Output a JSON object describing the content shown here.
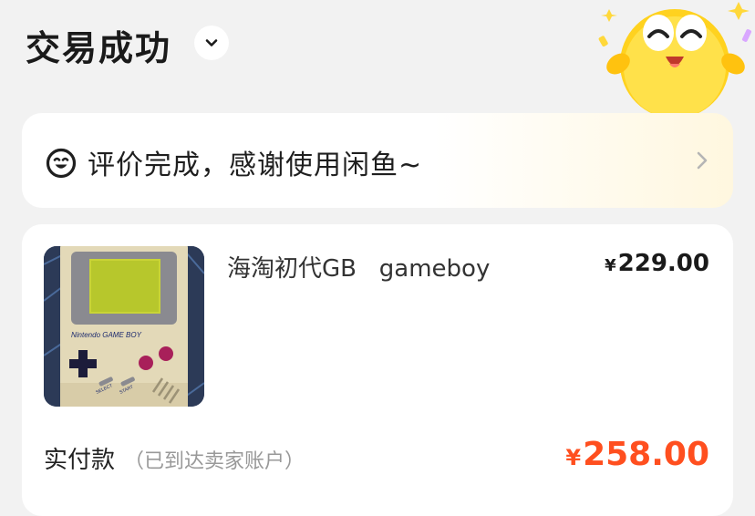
{
  "header": {
    "title": "交易成功",
    "toggle_icon": "chevron-down-icon"
  },
  "mascot": {
    "icon": "smiling-mascot-icon"
  },
  "review_banner": {
    "icon": "smile-face-icon",
    "text": "评价完成，感谢使用闲鱼~",
    "arrow_icon": "chevron-right-icon"
  },
  "order": {
    "product_title": "海淘初代GB   gameboy",
    "currency_symbol": "¥",
    "unit_price": "229.00",
    "paid_label": "实付款",
    "paid_note": "（已到达卖家账户）",
    "paid_amount": "258.00",
    "price_color": "#ff4f1f",
    "product_image": {
      "subject": "Nintendo Game Boy handheld console",
      "brand_text": "Nintendo GAME BOY",
      "button_labels": [
        "SELECT",
        "START"
      ]
    }
  }
}
